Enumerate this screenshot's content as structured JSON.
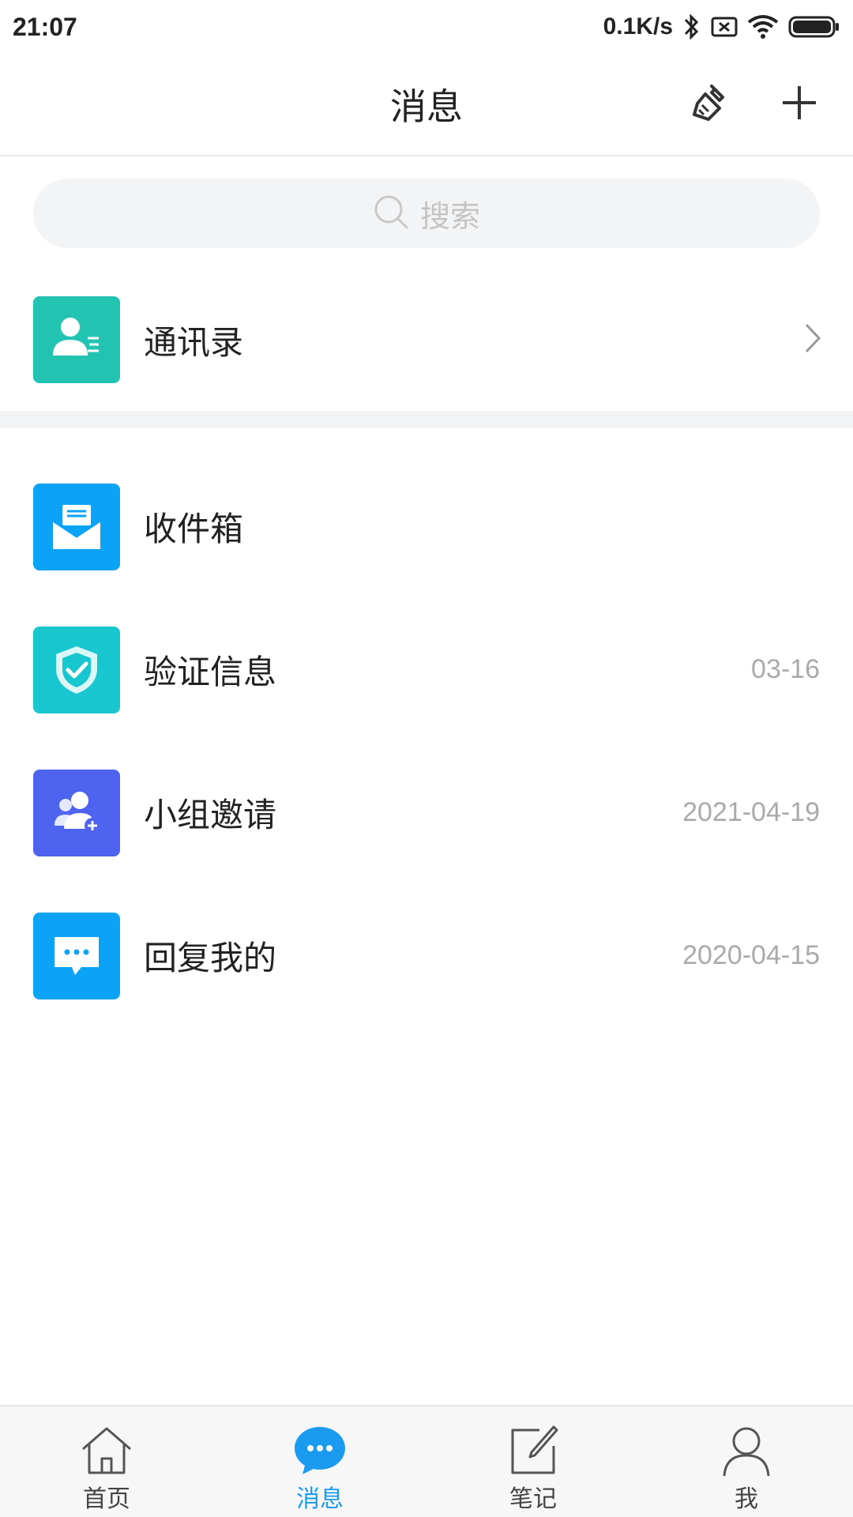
{
  "status_bar": {
    "time": "21:07",
    "network_speed": "0.1K/s",
    "icons": [
      "bluetooth-icon",
      "sim-none-icon",
      "wifi-icon",
      "battery-icon"
    ]
  },
  "header": {
    "title": "消息",
    "actions": [
      "broom-clean-icon",
      "plus-icon"
    ]
  },
  "search": {
    "placeholder": "搜索"
  },
  "contacts": {
    "label": "通讯录",
    "icon": "contact-card-icon",
    "color": "#22c3b1"
  },
  "messages": [
    {
      "label": "收件箱",
      "date": "",
      "icon": "mail-open-icon",
      "color": "#0aa3f5"
    },
    {
      "label": "验证信息",
      "date": "03-16",
      "icon": "shield-check-icon",
      "color": "#18c6cf"
    },
    {
      "label": "小组邀请",
      "date": "2021-04-19",
      "icon": "group-add-icon",
      "color": "#4e63f0"
    },
    {
      "label": "回复我的",
      "date": "2020-04-15",
      "icon": "chat-bubble-icon",
      "color": "#0aa3f5"
    }
  ],
  "tabbar": {
    "active_color": "#1a9bf0",
    "tabs": [
      {
        "label": "首页",
        "icon": "home-icon",
        "active": false
      },
      {
        "label": "消息",
        "icon": "message-icon",
        "active": true
      },
      {
        "label": "笔记",
        "icon": "edit-note-icon",
        "active": false
      },
      {
        "label": "我",
        "icon": "person-icon",
        "active": false
      }
    ]
  }
}
